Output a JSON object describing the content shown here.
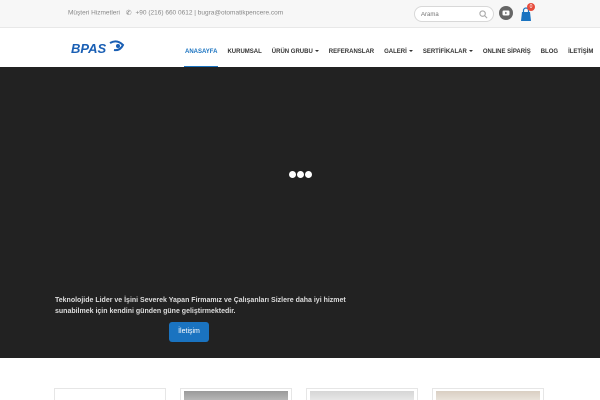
{
  "topbar": {
    "customer_service": "Müşteri Hizmetleri",
    "phone": "+90 (216) 660 0612",
    "separator": "|",
    "email": "bugra@otomatikpencere.com",
    "search_placeholder": "Arama",
    "cart_count": "0"
  },
  "logo": {
    "text": "BPAS"
  },
  "nav": {
    "items": [
      {
        "label": "ANASAYFA"
      },
      {
        "label": "KURUMSAL"
      },
      {
        "label": "ÜRÜN GRUBU"
      },
      {
        "label": "REFERANSLAR"
      },
      {
        "label": "GALERİ"
      },
      {
        "label": "SERTİFİKALAR"
      },
      {
        "label": "ONLINE SİPARİŞ"
      },
      {
        "label": "BLOG"
      },
      {
        "label": "İLETİŞİM"
      }
    ]
  },
  "hero": {
    "text": "Teknolojide Lider ve İşini Severek Yapan Firmamız ve Çalışanları Sizlere daha iyi hizmet sunabilmek için kendini günden güne geliştirmektedir.",
    "button": "İletişim"
  },
  "colors": {
    "accent": "#1a73c0",
    "hero_bg": "#222222",
    "badge": "#e74c3c"
  }
}
